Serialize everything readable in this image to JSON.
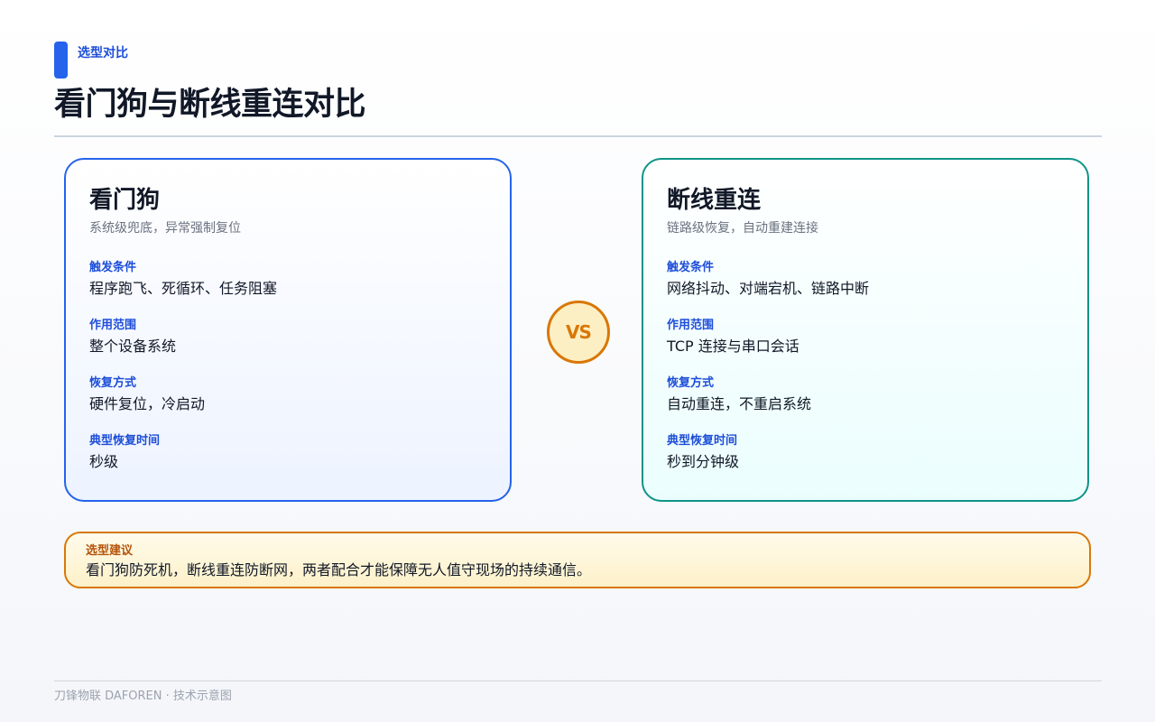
{
  "header": {
    "tag": "选型对比",
    "title": "看门狗与断线重连对比"
  },
  "cards": [
    {
      "title": "看门狗",
      "subtitle": "系统级兜底，异常强制复位",
      "fields": [
        {
          "label": "触发条件",
          "value": "程序跑飞、死循环、任务阻塞"
        },
        {
          "label": "作用范围",
          "value": "整个设备系统"
        },
        {
          "label": "恢复方式",
          "value": "硬件复位，冷启动"
        },
        {
          "label": "典型恢复时间",
          "value": "秒级"
        }
      ]
    },
    {
      "title": "断线重连",
      "subtitle": "链路级恢复，自动重建连接",
      "fields": [
        {
          "label": "触发条件",
          "value": "网络抖动、对端宕机、链路中断"
        },
        {
          "label": "作用范围",
          "value": "TCP 连接与串口会话"
        },
        {
          "label": "恢复方式",
          "value": "自动重连，不重启系统"
        },
        {
          "label": "典型恢复时间",
          "value": "秒到分钟级"
        }
      ]
    }
  ],
  "vs_label": "VS",
  "advice": {
    "label": "选型建议",
    "text": "看门狗防死机，断线重连防断网，两者配合才能保障无人值守现场的持续通信。"
  },
  "footer": {
    "text": "刀锋物联 DAFOREN · 技术示意图"
  },
  "colors": {
    "accent_blue": "#2563eb",
    "accent_teal": "#0d9488",
    "accent_amber": "#d97706"
  }
}
